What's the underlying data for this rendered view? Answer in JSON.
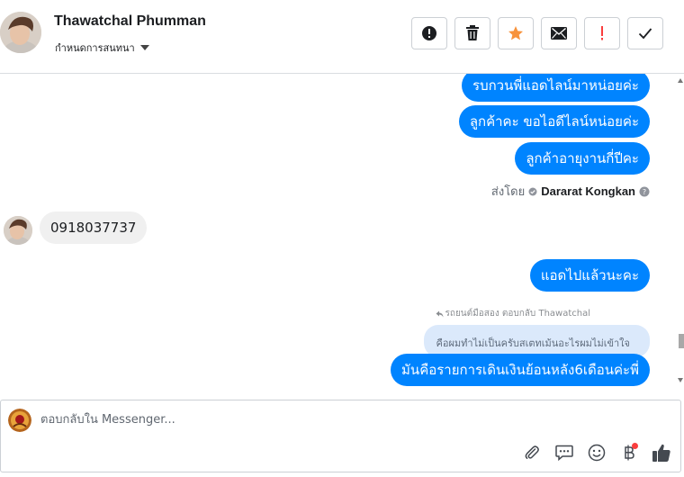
{
  "header": {
    "contact_name": "Thawatchal Phumman",
    "convo_settings": "กำหนดการสนทนา",
    "buttons": [
      {
        "name": "spam-button",
        "icon": "exclamation-circle-icon"
      },
      {
        "name": "delete-button",
        "icon": "trash-icon"
      },
      {
        "name": "star-button",
        "icon": "star-icon",
        "color": "#f7923b"
      },
      {
        "name": "mark-unread-button",
        "icon": "envelope-icon"
      },
      {
        "name": "follow-up-button",
        "icon": "exclamation-icon",
        "color": "#fa3e3e"
      },
      {
        "name": "done-button",
        "icon": "check-icon"
      }
    ]
  },
  "messages": {
    "out1": "รบกวนพี่แอดไลน์มาหน่อยค่ะ",
    "out2": "ลูกค้าคะ ขอไอดีไลน์หน่อยค่ะ",
    "out3": "ลูกค้าอายุงานกี่ปีคะ",
    "sent_by_label": "ส่งโดย",
    "sent_by_name": "Dararat Kongkan",
    "in1": "0918037737",
    "out4": "แอดไปแล้วนะคะ",
    "reply_note": "รถยนต์มือสอง ตอบกลับ Thawatchal",
    "quoted_text": "คือผมทำไม่เป็นครับสเตทเม้นอะไรผมไม่เข้าใจ",
    "out5": "มันคือรายการเดินเงินย้อนหลัง6เดือนค่ะพี่"
  },
  "composer": {
    "placeholder": "ตอบกลับใน Messenger...",
    "value": "",
    "icons": [
      "paperclip-icon",
      "saved-reply-icon",
      "emoji-icon",
      "baht-payment-icon",
      "thumbs-up-icon"
    ]
  },
  "colors": {
    "accent": "#0084ff",
    "incoming": "#f0f0f0",
    "quoted": "#dbe9fb",
    "star": "#f7923b",
    "alert": "#fa3e3e"
  }
}
